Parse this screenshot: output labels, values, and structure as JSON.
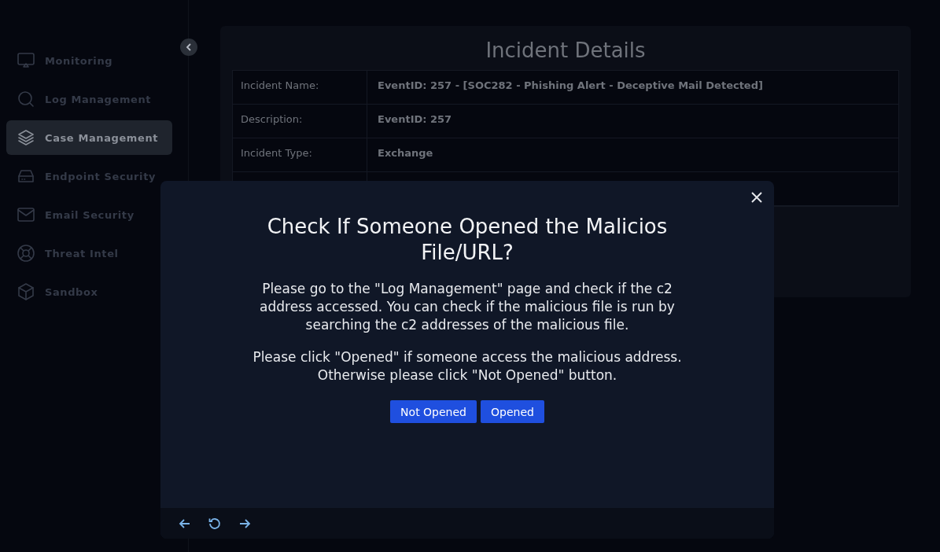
{
  "sidebar": {
    "items": [
      {
        "label": "Monitoring",
        "selected": false
      },
      {
        "label": "Log Management",
        "selected": false
      },
      {
        "label": "Case Management",
        "selected": true
      },
      {
        "label": "Endpoint Security",
        "selected": false
      },
      {
        "label": "Email Security",
        "selected": false
      },
      {
        "label": "Threat Intel",
        "selected": false
      },
      {
        "label": "Sandbox",
        "selected": false
      }
    ]
  },
  "panel": {
    "title": "Incident Details",
    "rows": [
      {
        "label": "Incident Name:",
        "value": "EventID: 257 - [SOC282 - Phishing Alert - Deceptive Mail Detected]"
      },
      {
        "label": "Description:",
        "value": "EventID: 257"
      },
      {
        "label": "Incident Type:",
        "value": "Exchange"
      }
    ]
  },
  "dialog": {
    "title": "Check If Someone Opened the Malicios File/URL?",
    "paragraphs": [
      "Please go to the \"Log Management\" page and check if the c2 address accessed. You can check if the malicious file is run by searching the c2 addresses of the malicious file.",
      "Please click \"Opened\" if someone access the malicious address. Otherwise please click \"Not Opened\" button."
    ],
    "buttons": [
      "Not Opened",
      "Opened"
    ]
  }
}
